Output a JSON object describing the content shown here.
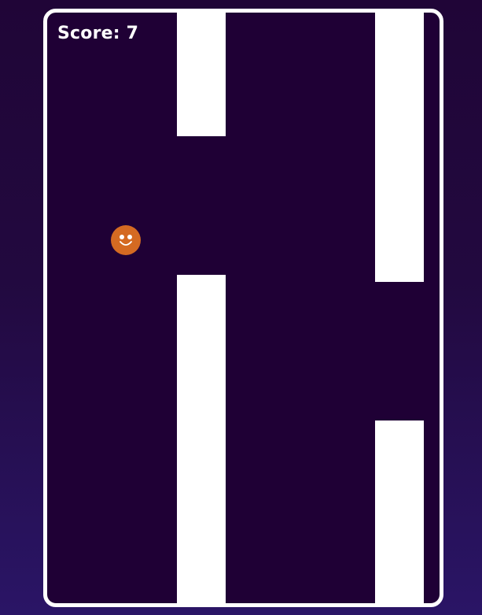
{
  "hud": {
    "score_text": "Score: 7"
  },
  "colors": {
    "background_top": "#200537",
    "background_bottom": "#2a1566",
    "playfield": "#1f0035",
    "frame_border": "#ffffff",
    "pipe": "#ffffff",
    "player_body": "#d46a22",
    "player_face": "#ffffff"
  },
  "player": {
    "icon": "smiley-face-icon"
  },
  "pipes": [
    {
      "name": "left-top"
    },
    {
      "name": "left-bottom"
    },
    {
      "name": "right-top"
    },
    {
      "name": "right-bottom"
    }
  ]
}
